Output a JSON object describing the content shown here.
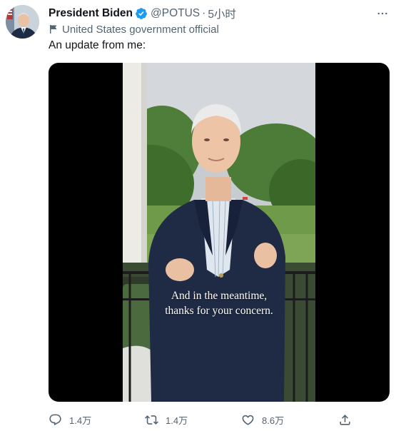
{
  "author": {
    "name": "President Biden",
    "handle": "@POTUS",
    "separator": "·",
    "time": "5小时",
    "affiliation": "United States government official",
    "verified_color": "#1d9bf0"
  },
  "tweet": {
    "text": "An update from me:"
  },
  "video": {
    "caption_line1": "And in the meantime,",
    "caption_line2": "thanks for your concern."
  },
  "actions": {
    "reply_count": "1.4万",
    "retweet_count": "1.4万",
    "like_count": "8.6万"
  },
  "icons": {
    "more": "more-icon",
    "verified": "verified-badge-icon",
    "affiliation": "flag-icon",
    "reply": "reply-icon",
    "retweet": "retweet-icon",
    "like": "heart-icon",
    "share": "share-icon"
  }
}
